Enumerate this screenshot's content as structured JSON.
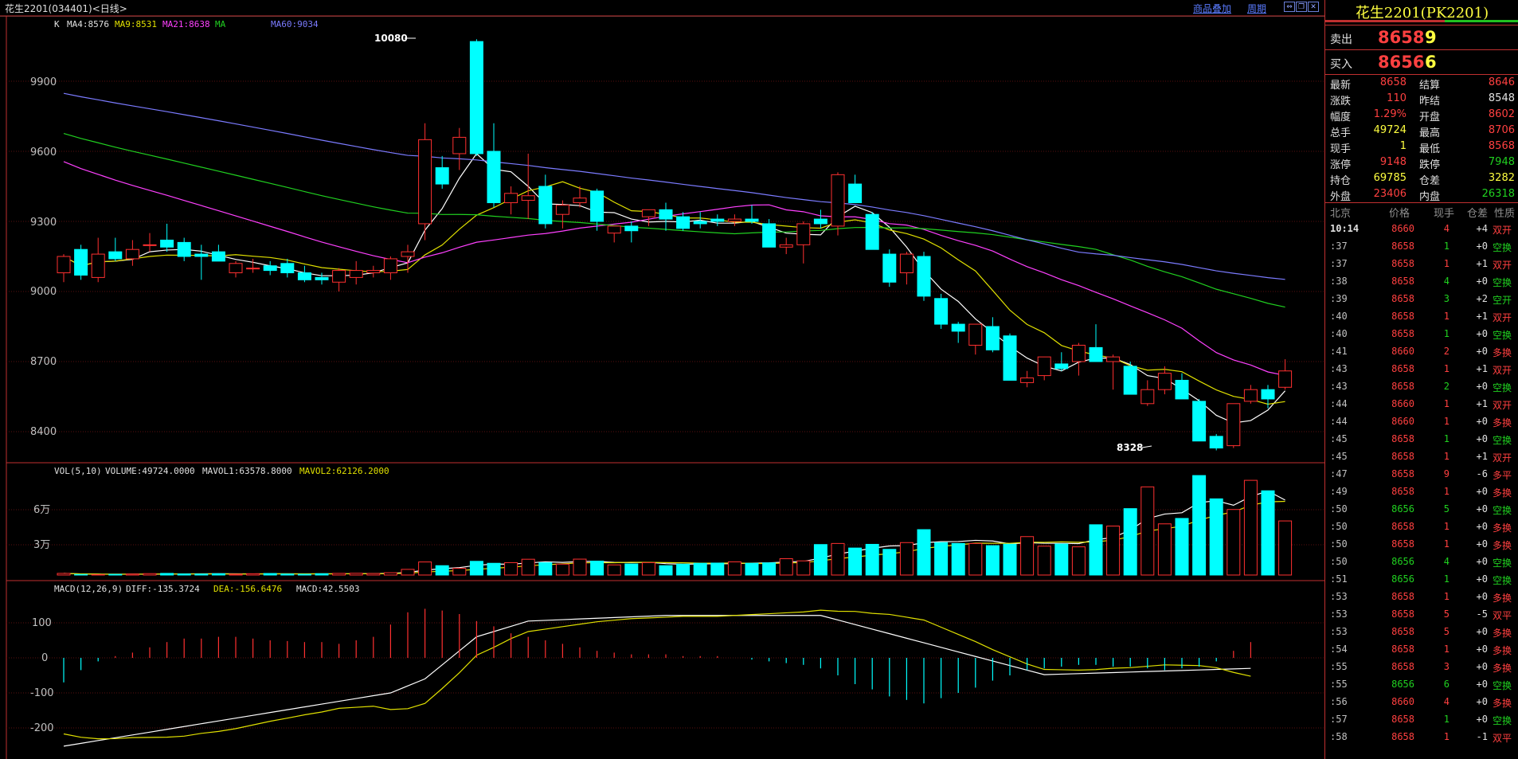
{
  "header": {
    "title": "花生2201(034401)<日线>",
    "overlay_link": "商品叠加",
    "period_link": "周期"
  },
  "kline": {
    "legend_prefix": "K",
    "ma4": "MA4:8576",
    "ma9": "MA9:8531",
    "ma21": "MA21:8638",
    "ma": "MA",
    "ma60": "MA60:9034",
    "y_ticks": [
      "9900",
      "9600",
      "9300",
      "9000",
      "8700",
      "8400"
    ],
    "high_label": "10080",
    "low_label": "8328"
  },
  "volume": {
    "legend_prefix": "VOL(5,10)",
    "volume": "VOLUME:49724.0000",
    "mavol1": "MAVOL1:63578.8000",
    "mavol2": "MAVOL2:62126.2000",
    "y_ticks": [
      "6万",
      "3万"
    ]
  },
  "macd": {
    "legend_prefix": "MACD(12,26,9)",
    "diff": "DIFF:-135.3724",
    "dea": "DEA:-156.6476",
    "macd": "MACD:42.5503",
    "y_ticks": [
      "100",
      "0",
      "-100",
      "-200"
    ]
  },
  "chart_data": {
    "type": "candlestick",
    "title": "花生2201(034401)<日线>",
    "ylim": [
      8250,
      10150
    ],
    "ohlc": [
      [
        9080,
        9160,
        9040,
        9150
      ],
      [
        9180,
        9200,
        9050,
        9070
      ],
      [
        9060,
        9230,
        9040,
        9160
      ],
      [
        9170,
        9230,
        9130,
        9140
      ],
      [
        9140,
        9220,
        9110,
        9180
      ],
      [
        9200,
        9250,
        9170,
        9200
      ],
      [
        9220,
        9290,
        9170,
        9190
      ],
      [
        9210,
        9230,
        9130,
        9150
      ],
      [
        9160,
        9200,
        9050,
        9150
      ],
      [
        9170,
        9200,
        9140,
        9130
      ],
      [
        9080,
        9130,
        9060,
        9120
      ],
      [
        9100,
        9140,
        9080,
        9100
      ],
      [
        9110,
        9130,
        9070,
        9090
      ],
      [
        9120,
        9140,
        9060,
        9080
      ],
      [
        9080,
        9110,
        9040,
        9050
      ],
      [
        9060,
        9080,
        9030,
        9050
      ],
      [
        9040,
        9100,
        9000,
        9090
      ],
      [
        9060,
        9130,
        9030,
        9090
      ],
      [
        9080,
        9110,
        9060,
        9090
      ],
      [
        9080,
        9150,
        9050,
        9140
      ],
      [
        9150,
        9200,
        9080,
        9170
      ],
      [
        9290,
        9720,
        9220,
        9650
      ],
      [
        9530,
        9580,
        9440,
        9460
      ],
      [
        9590,
        9700,
        9520,
        9660
      ],
      [
        10070,
        10080,
        9580,
        9590
      ],
      [
        9600,
        9720,
        9360,
        9380
      ],
      [
        9380,
        9450,
        9330,
        9420
      ],
      [
        9390,
        9590,
        9310,
        9410
      ],
      [
        9450,
        9500,
        9270,
        9290
      ],
      [
        9330,
        9390,
        9270,
        9370
      ],
      [
        9380,
        9450,
        9360,
        9400
      ],
      [
        9430,
        9440,
        9260,
        9300
      ],
      [
        9250,
        9280,
        9210,
        9280
      ],
      [
        9280,
        9300,
        9210,
        9260
      ],
      [
        9320,
        9340,
        9280,
        9350
      ],
      [
        9350,
        9380,
        9260,
        9310
      ],
      [
        9320,
        9340,
        9260,
        9270
      ],
      [
        9300,
        9340,
        9270,
        9290
      ],
      [
        9310,
        9330,
        9280,
        9300
      ],
      [
        9300,
        9330,
        9280,
        9310
      ],
      [
        9310,
        9370,
        9290,
        9300
      ],
      [
        9290,
        9310,
        9220,
        9190
      ],
      [
        9190,
        9230,
        9160,
        9200
      ],
      [
        9200,
        9300,
        9120,
        9290
      ],
      [
        9310,
        9350,
        9270,
        9290
      ],
      [
        9280,
        9510,
        9240,
        9500
      ],
      [
        9460,
        9500,
        9380,
        9380
      ],
      [
        9330,
        9340,
        9200,
        9180
      ],
      [
        9160,
        9180,
        9020,
        9040
      ],
      [
        9080,
        9170,
        9030,
        9160
      ],
      [
        9150,
        9170,
        8960,
        8980
      ],
      [
        8970,
        8990,
        8840,
        8860
      ],
      [
        8860,
        8870,
        8780,
        8830
      ],
      [
        8770,
        8850,
        8730,
        8860
      ],
      [
        8850,
        8890,
        8740,
        8750
      ],
      [
        8810,
        8820,
        8620,
        8620
      ],
      [
        8610,
        8660,
        8590,
        8630
      ],
      [
        8640,
        8720,
        8620,
        8720
      ],
      [
        8690,
        8740,
        8660,
        8670
      ],
      [
        8700,
        8780,
        8640,
        8770
      ],
      [
        8760,
        8860,
        8700,
        8700
      ],
      [
        8700,
        8730,
        8580,
        8720
      ],
      [
        8680,
        8700,
        8560,
        8560
      ],
      [
        8520,
        8620,
        8510,
        8580
      ],
      [
        8580,
        8680,
        8560,
        8650
      ],
      [
        8620,
        8650,
        8540,
        8540
      ],
      [
        8530,
        8540,
        8360,
        8360
      ],
      [
        8380,
        8390,
        8320,
        8330
      ],
      [
        8340,
        8490,
        8330,
        8520
      ],
      [
        8530,
        8600,
        8520,
        8580
      ],
      [
        8580,
        8600,
        8500,
        8540
      ],
      [
        8590,
        8710,
        8580,
        8660
      ]
    ],
    "volume": [
      1500,
      500,
      400,
      600,
      900,
      1300,
      1500,
      1000,
      900,
      1200,
      800,
      1200,
      1400,
      900,
      700,
      1200,
      1500,
      1600,
      1400,
      2100,
      5200,
      12000,
      8600,
      6200,
      12600,
      10800,
      11400,
      14500,
      11300,
      10000,
      14600,
      12800,
      9300,
      10200,
      11400,
      8600,
      10000,
      10800,
      11000,
      12100,
      10800,
      11200,
      15000,
      13000,
      28000,
      29000,
      24800,
      28200,
      23600,
      29800,
      41700,
      29800,
      29000,
      29000,
      27000,
      28300,
      35300,
      26500,
      28500,
      25900,
      46200,
      45000,
      61000,
      81000,
      47000,
      52000,
      91400,
      70000,
      60200,
      87000,
      77400,
      49700
    ],
    "macd_hist": [
      -70,
      -35,
      -10,
      5,
      15,
      30,
      45,
      55,
      55,
      60,
      60,
      55,
      50,
      48,
      45,
      45,
      40,
      50,
      60,
      95,
      130,
      140,
      135,
      125,
      105,
      90,
      70,
      60,
      50,
      40,
      30,
      20,
      15,
      10,
      10,
      10,
      5,
      5,
      5,
      0,
      -5,
      -10,
      -15,
      -20,
      -30,
      -50,
      -75,
      -90,
      -110,
      -120,
      -130,
      -115,
      -100,
      -85,
      -65,
      -50,
      -35,
      -30,
      -25,
      -20,
      -20,
      -25,
      -25,
      -30,
      -35,
      -30,
      -25,
      -10,
      20,
      45
    ]
  }
}
